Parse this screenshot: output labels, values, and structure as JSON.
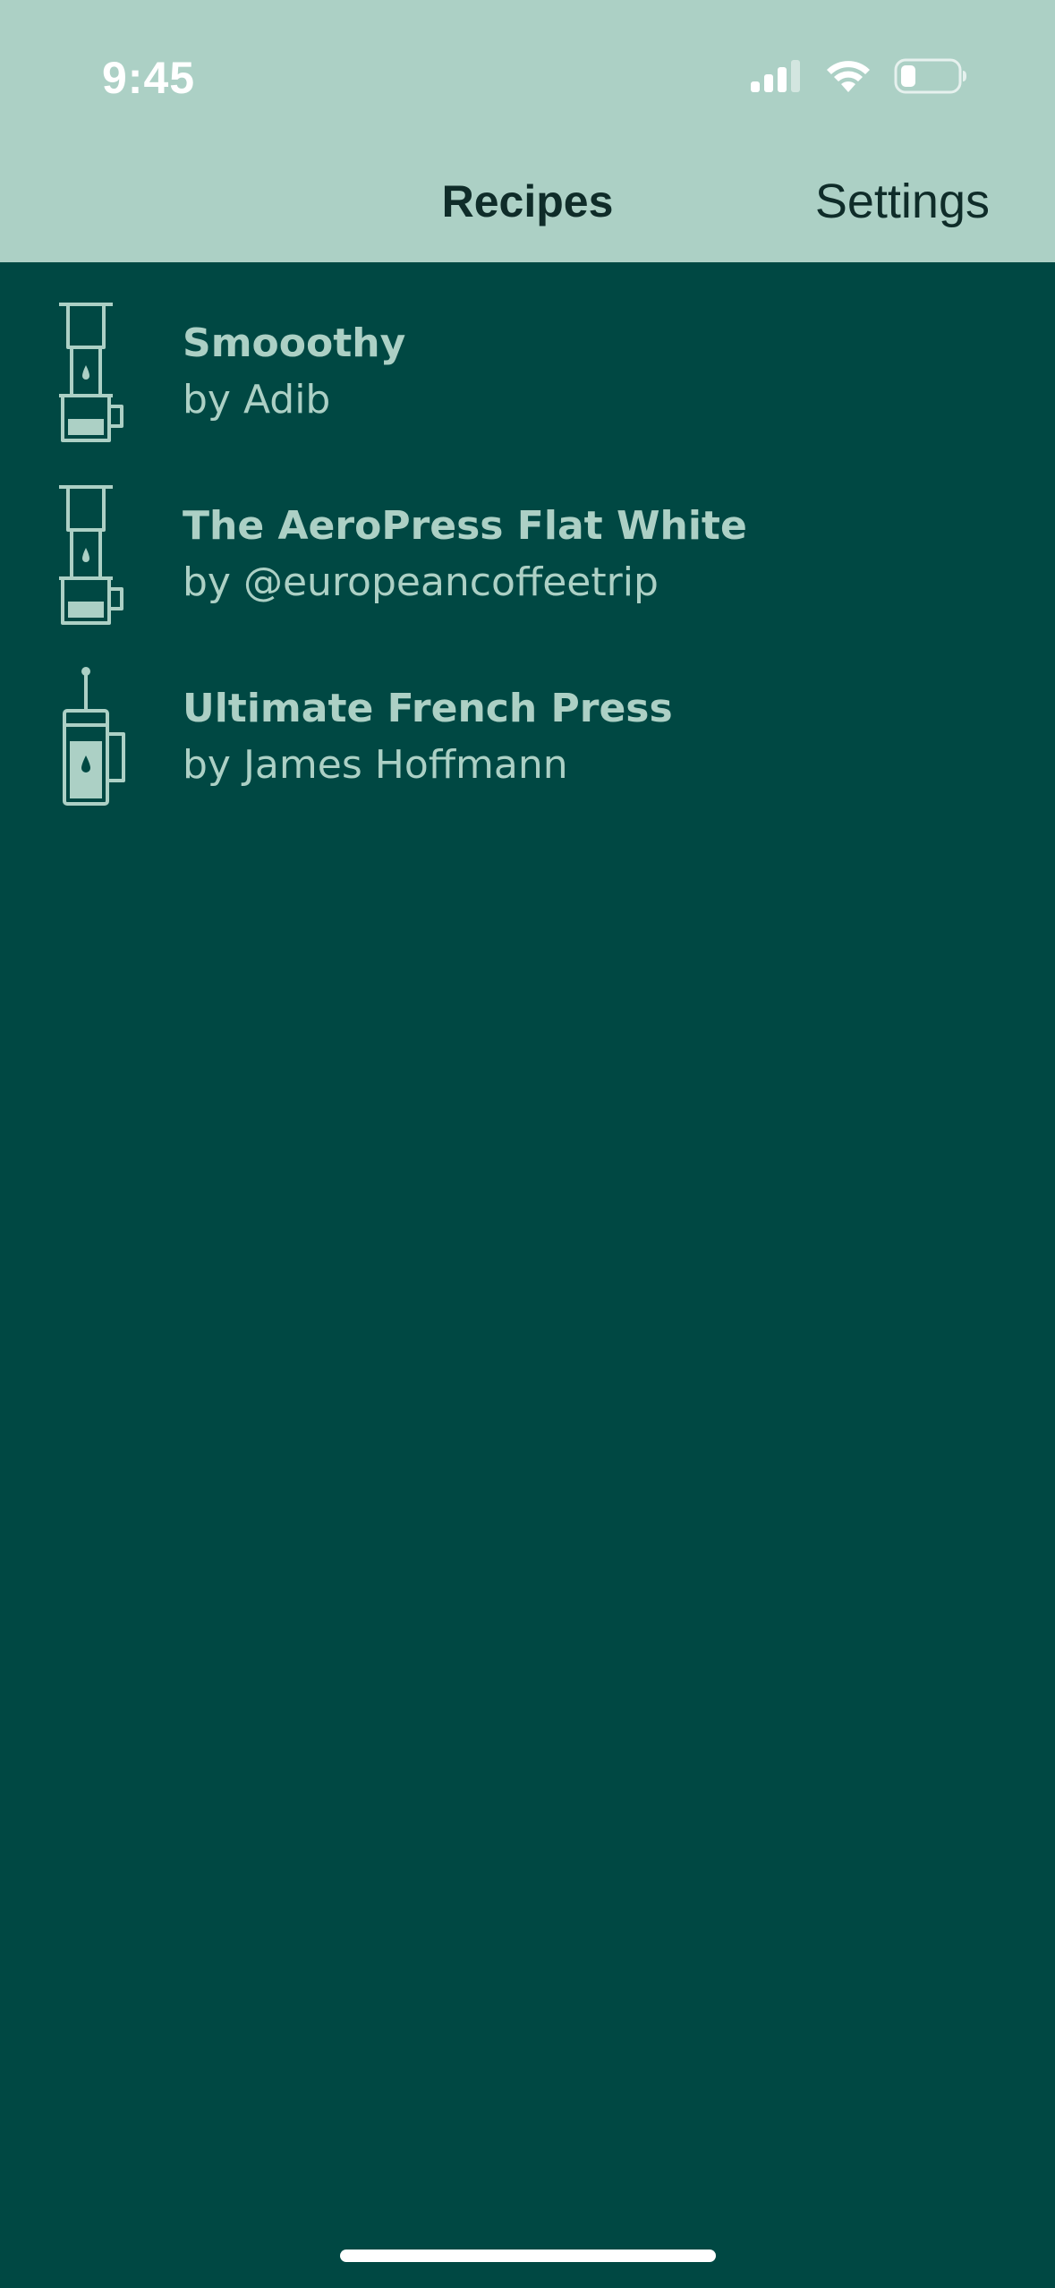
{
  "status_bar": {
    "time": "9:45",
    "icons": [
      "cellular-signal-icon",
      "wifi-icon",
      "battery-icon"
    ]
  },
  "nav": {
    "title": "Recipes",
    "settings_label": "Settings"
  },
  "recipes": [
    {
      "name": "Smooothy",
      "author": "by Adib",
      "icon": "aeropress-icon"
    },
    {
      "name": "The AeroPress Flat White",
      "author": "by @europeancoffeetrip",
      "icon": "aeropress-icon"
    },
    {
      "name": "Ultimate French Press",
      "author": "by James Hoffmann",
      "icon": "french-press-icon"
    }
  ],
  "colors": {
    "header_bg": "#acd0c5",
    "content_bg": "#004843",
    "text_light": "#acd0c5",
    "text_dark": "#0f2c29"
  }
}
